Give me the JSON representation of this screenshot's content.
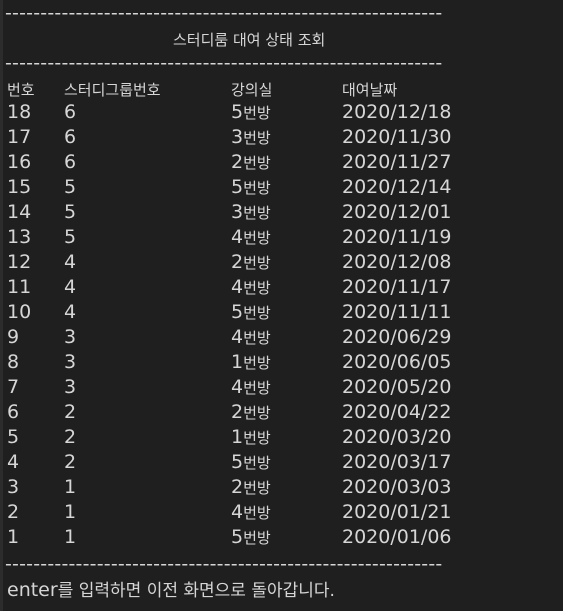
{
  "console": {
    "separator_top": "--------------------------------------------------------------",
    "title": "스터디룸 대여 상태 조회",
    "separator_mid": "--------------------------------------------------------------",
    "columns": [
      "번호",
      "스터디그룹번호",
      "강의실",
      "대여날짜"
    ],
    "room_unit": "번방",
    "rows": [
      {
        "no": "18",
        "group": "6",
        "room": "5",
        "date": "2020/12/18"
      },
      {
        "no": "17",
        "group": "6",
        "room": "3",
        "date": "2020/11/30"
      },
      {
        "no": "16",
        "group": "6",
        "room": "2",
        "date": "2020/11/27"
      },
      {
        "no": "15",
        "group": "5",
        "room": "5",
        "date": "2020/12/14"
      },
      {
        "no": "14",
        "group": "5",
        "room": "3",
        "date": "2020/12/01"
      },
      {
        "no": "13",
        "group": "5",
        "room": "4",
        "date": "2020/11/19"
      },
      {
        "no": "12",
        "group": "4",
        "room": "2",
        "date": "2020/12/08"
      },
      {
        "no": "11",
        "group": "4",
        "room": "4",
        "date": "2020/11/17"
      },
      {
        "no": "10",
        "group": "4",
        "room": "5",
        "date": "2020/11/11"
      },
      {
        "no": "9",
        "group": "3",
        "room": "4",
        "date": "2020/06/29"
      },
      {
        "no": "8",
        "group": "3",
        "room": "1",
        "date": "2020/06/05"
      },
      {
        "no": "7",
        "group": "3",
        "room": "4",
        "date": "2020/05/20"
      },
      {
        "no": "6",
        "group": "2",
        "room": "2",
        "date": "2020/04/22"
      },
      {
        "no": "5",
        "group": "2",
        "room": "1",
        "date": "2020/03/20"
      },
      {
        "no": "4",
        "group": "2",
        "room": "5",
        "date": "2020/03/17"
      },
      {
        "no": "3",
        "group": "1",
        "room": "2",
        "date": "2020/03/03"
      },
      {
        "no": "2",
        "group": "1",
        "room": "4",
        "date": "2020/01/21"
      },
      {
        "no": "1",
        "group": "1",
        "room": "5",
        "date": "2020/01/06"
      }
    ],
    "separator_bottom": "--------------------------------------------------------------",
    "footer_key": "enter",
    "footer_text": "를 입력하면 이전 화면으로 돌아갑니다."
  },
  "colors": {
    "background": "#1f1f1f",
    "text": "#d6d6d6"
  }
}
